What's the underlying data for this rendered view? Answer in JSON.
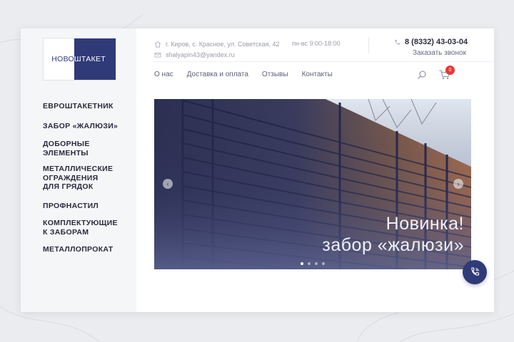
{
  "logo": {
    "part1": "НОВО",
    "part2": "ШТАКЕТ",
    "alt_icon": "logo"
  },
  "sidebar": {
    "items": [
      {
        "label": "ЕВРОШТАКЕТНИК"
      },
      {
        "label": "ЗАБОР «ЖАЛЮЗИ»"
      },
      {
        "label": "ДОБОРНЫЕ ЭЛЕМЕНТЫ"
      },
      {
        "label": "МЕТАЛЛИЧЕСКИЕ ОГРАЖДЕНИЯ ДЛЯ ГРЯДОК"
      },
      {
        "label": "ПРОФНАСТИЛ"
      },
      {
        "label": "КОМПЛЕКТУЮЩИЕ К ЗАБОРАМ"
      },
      {
        "label": "МЕТАЛЛОПРОКАТ"
      }
    ]
  },
  "header": {
    "address": "г. Киров, с. Красное, ул. Советская, 42",
    "email": "shalyapin43@yandex.ru",
    "hours": "пн-вс 9:00-18:00",
    "phone": "8 (8332) 43-03-04",
    "callback_label": "Заказать звонок",
    "address_icon": "home-icon",
    "email_icon": "mail-icon",
    "phone_icon": "phone-icon"
  },
  "nav": {
    "items": [
      {
        "label": "О нас"
      },
      {
        "label": "Доставка и оплата"
      },
      {
        "label": "Отзывы"
      },
      {
        "label": "Контакты"
      }
    ]
  },
  "cart": {
    "count": "0"
  },
  "slider": {
    "line1": "Новинка!",
    "line2": "забор «жалюзи»",
    "dots_count": 4,
    "active_dot": 0
  },
  "colors": {
    "brand": "#2f3a78",
    "badge": "#e53935",
    "background": "#ebecef"
  }
}
